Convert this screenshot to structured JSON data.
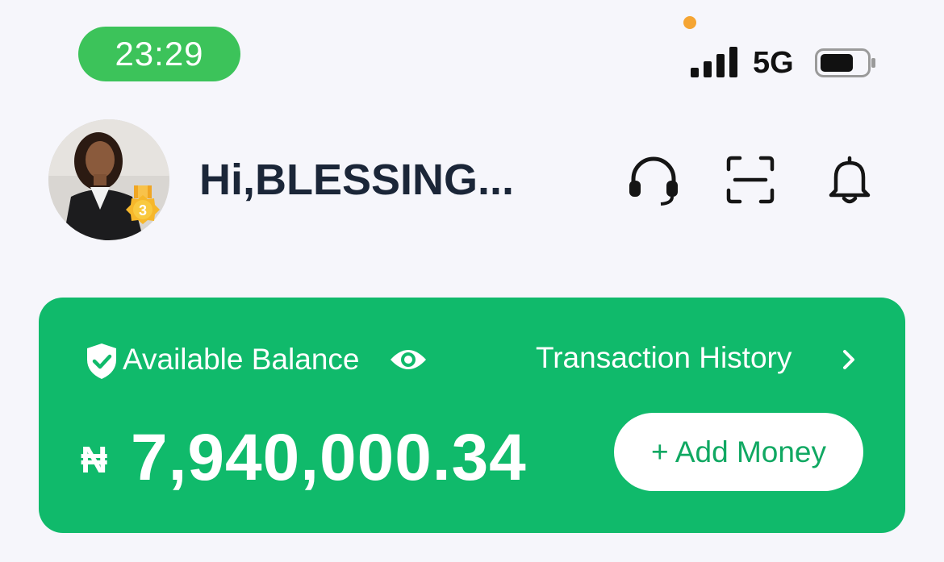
{
  "status_bar": {
    "time": "23:29",
    "network": "5G",
    "signal_bars": 4,
    "colors": {
      "time_pill": "#3cc35a",
      "privacy_dot": "#f5a533"
    }
  },
  "header": {
    "greeting": "Hi,BLESSING...",
    "avatar_badge_level": "3",
    "icons": [
      "headset-icon",
      "scan-icon",
      "bell-icon"
    ]
  },
  "balance_card": {
    "label": "Available Balance",
    "transaction_history_label": "Transaction History",
    "currency_symbol": "₦",
    "amount": "7,940,000.34",
    "add_money_label": "+ Add Money",
    "accent_color": "#10ba6b"
  }
}
